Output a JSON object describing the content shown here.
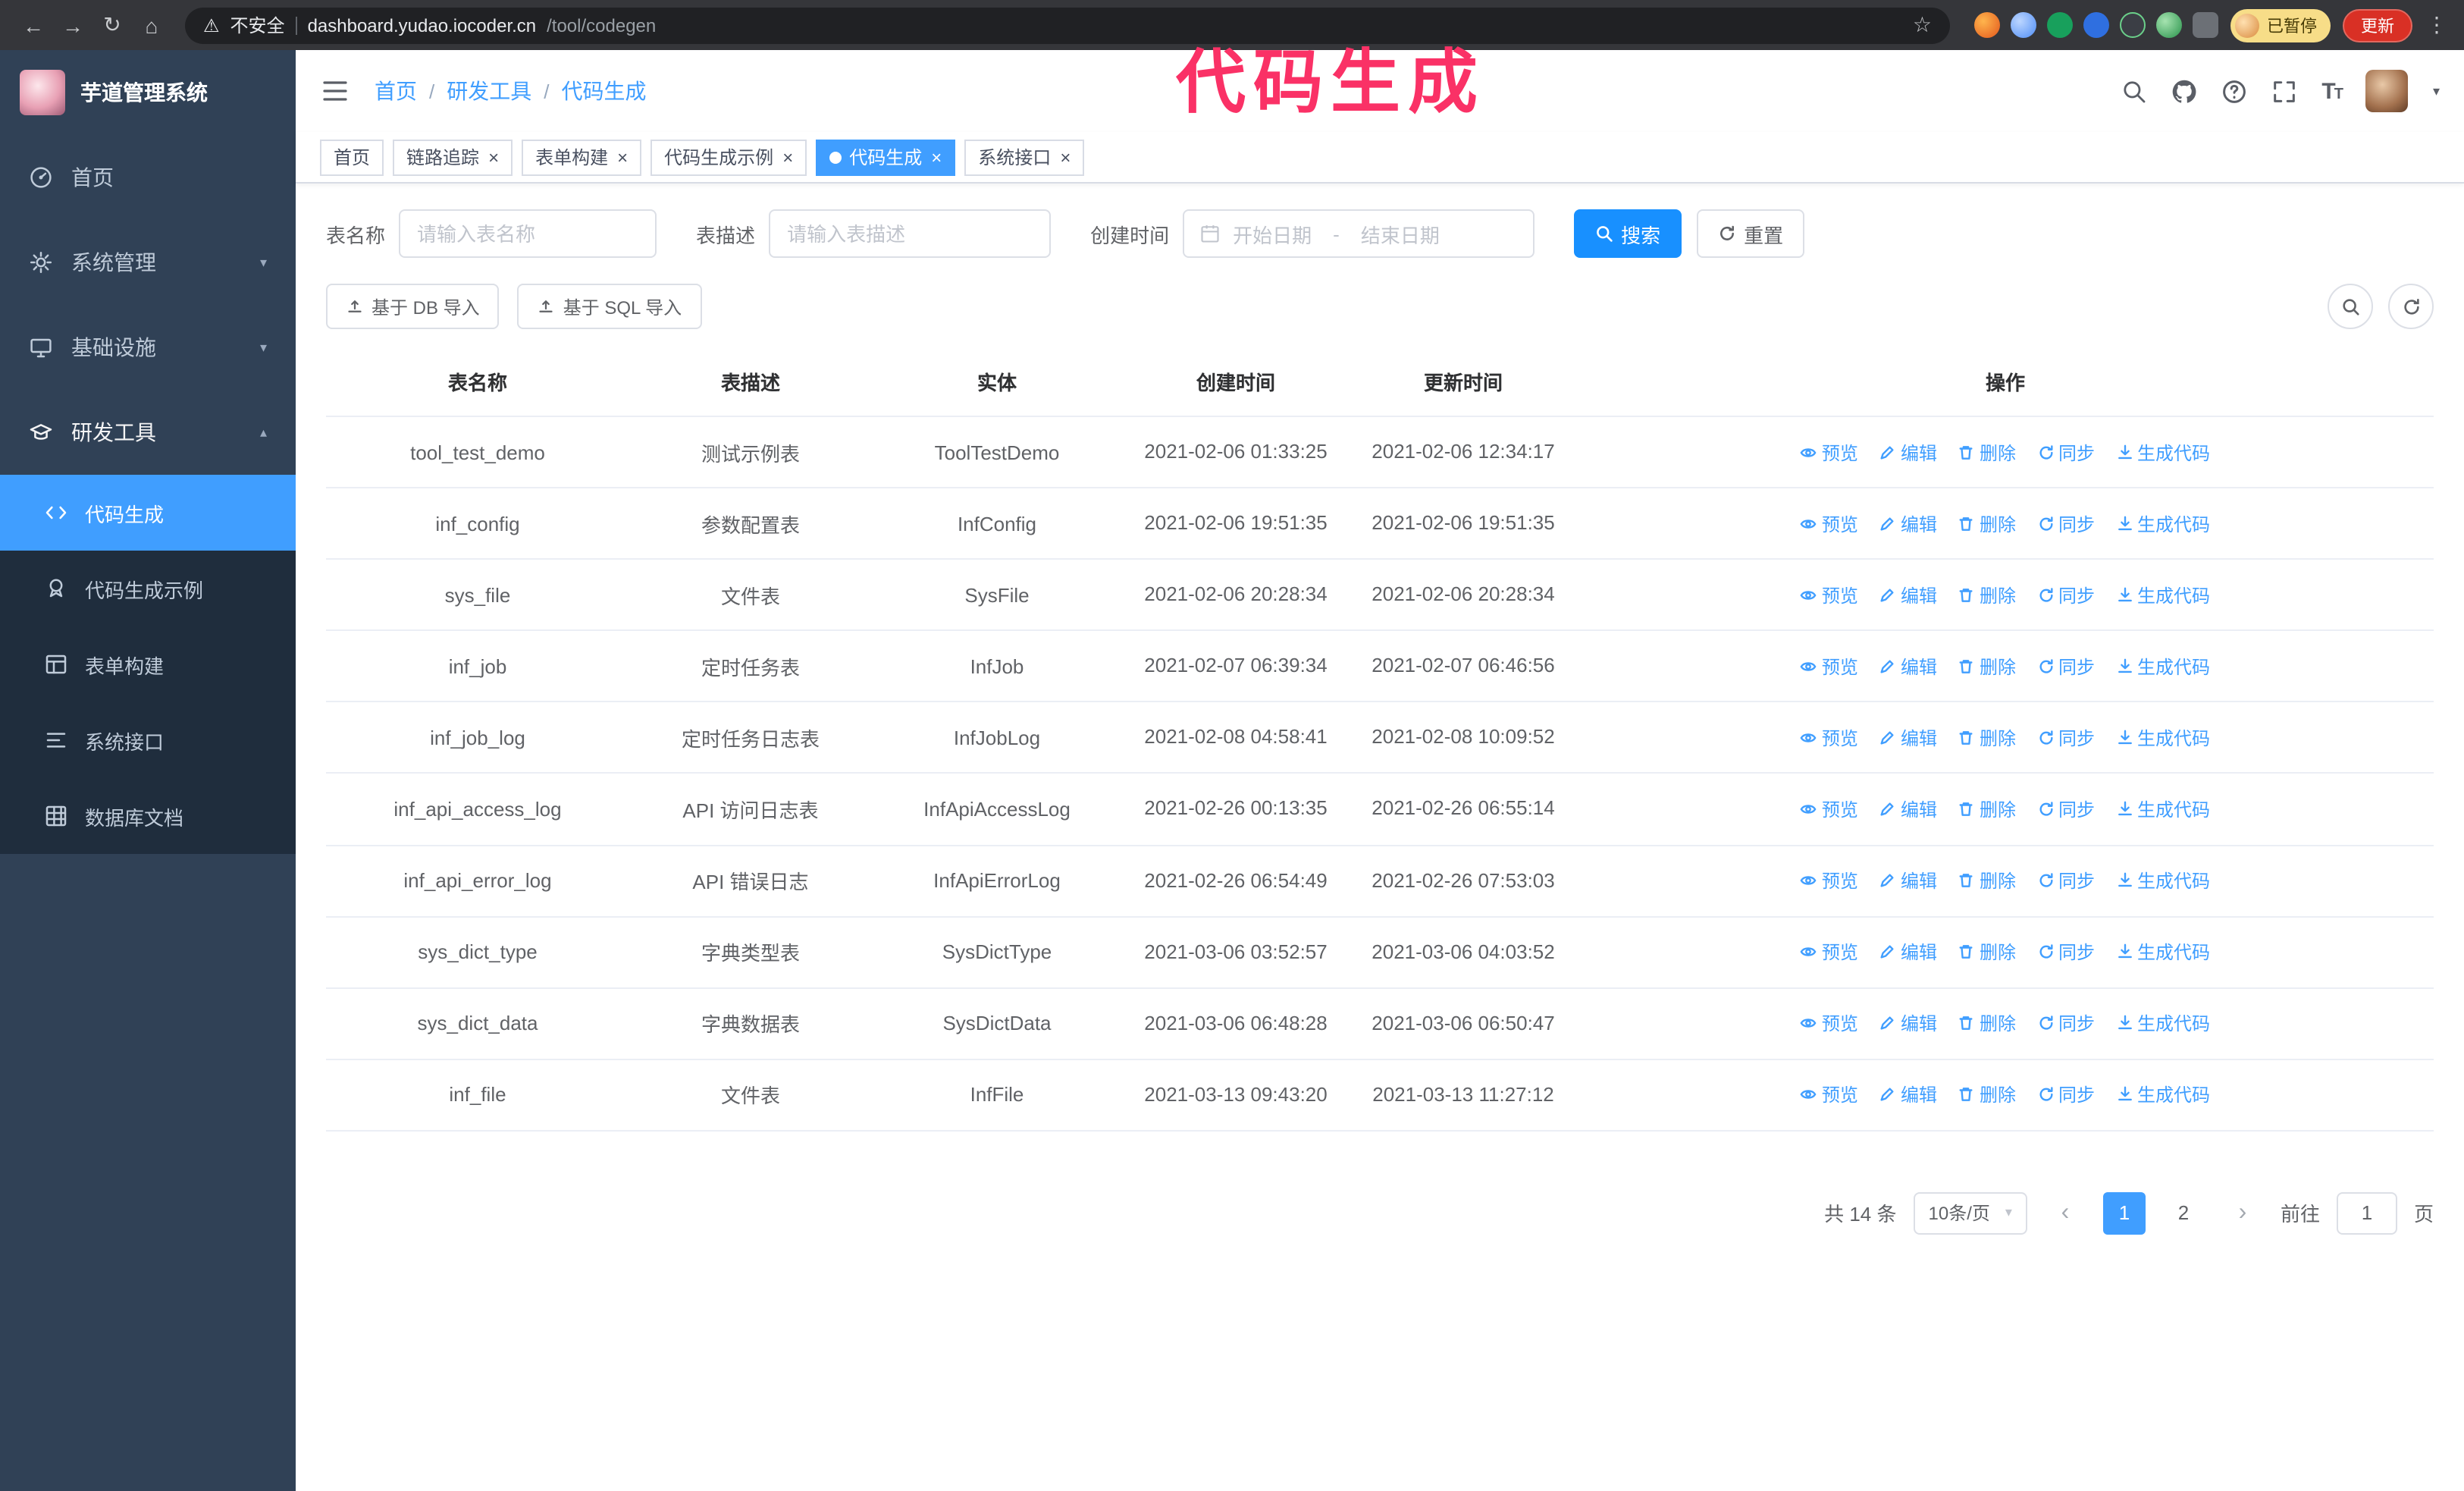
{
  "colors": {
    "primary": "#409eff",
    "primary_dark": "#1890ff",
    "annotation": "#fa3166",
    "update_red": "#d93025",
    "paused_yellow": "#f7dd88",
    "sidebar_bg": "#304156",
    "submenu_bg": "#1f2d3d"
  },
  "browser": {
    "security_label": "不安全",
    "url_host": "dashboard.yudao.iocoder.cn",
    "url_path": "/tool/codegen",
    "paused_badge": "已暂停",
    "update_label": "更新"
  },
  "annotation": {
    "text": "代码生成"
  },
  "sidebar": {
    "logo_title": "芋道管理系统",
    "items": [
      {
        "label": "首页",
        "icon": "dashboard-icon"
      },
      {
        "label": "系统管理",
        "icon": "gear-icon"
      },
      {
        "label": "基础设施",
        "icon": "monitor-icon"
      },
      {
        "label": "研发工具",
        "icon": "education-icon"
      }
    ],
    "subitems": [
      {
        "label": "代码生成",
        "icon": "code-icon",
        "active": true
      },
      {
        "label": "代码生成示例",
        "icon": "example-icon",
        "active": false
      },
      {
        "label": "表单构建",
        "icon": "form-icon",
        "active": false
      },
      {
        "label": "系统接口",
        "icon": "api-icon",
        "active": false
      },
      {
        "label": "数据库文档",
        "icon": "database-icon",
        "active": false
      }
    ]
  },
  "navbar": {
    "breadcrumb": [
      "首页",
      "研发工具",
      "代码生成"
    ],
    "separator": "/"
  },
  "tags": [
    {
      "label": "首页",
      "closable": false,
      "active": false
    },
    {
      "label": "链路追踪",
      "closable": true,
      "active": false
    },
    {
      "label": "表单构建",
      "closable": true,
      "active": false
    },
    {
      "label": "代码生成示例",
      "closable": true,
      "active": false
    },
    {
      "label": "代码生成",
      "closable": true,
      "active": true
    },
    {
      "label": "系统接口",
      "closable": true,
      "active": false
    }
  ],
  "filters": {
    "table_name_label": "表名称",
    "table_name_placeholder": "请输入表名称",
    "table_desc_label": "表描述",
    "table_desc_placeholder": "请输入表描述",
    "create_time_label": "创建时间",
    "date_start_placeholder": "开始日期",
    "date_separator": "-",
    "date_end_placeholder": "结束日期",
    "search_label": "搜索",
    "reset_label": "重置"
  },
  "toolbar": {
    "import_db_label": "基于 DB 导入",
    "import_sql_label": "基于 SQL 导入"
  },
  "table": {
    "columns": [
      "表名称",
      "表描述",
      "实体",
      "创建时间",
      "更新时间",
      "操作"
    ],
    "actions": [
      {
        "key": "preview",
        "label": "预览"
      },
      {
        "key": "edit",
        "label": "编辑"
      },
      {
        "key": "delete",
        "label": "删除"
      },
      {
        "key": "sync",
        "label": "同步"
      },
      {
        "key": "generate",
        "label": "生成代码"
      }
    ],
    "rows": [
      {
        "name": "tool_test_demo",
        "desc": "测试示例表",
        "entity": "ToolTestDemo",
        "created": "2021-02-06 01:33:25",
        "updated": "2021-02-06 12:34:17"
      },
      {
        "name": "inf_config",
        "desc": "参数配置表",
        "entity": "InfConfig",
        "created": "2021-02-06 19:51:35",
        "updated": "2021-02-06 19:51:35"
      },
      {
        "name": "sys_file",
        "desc": "文件表",
        "entity": "SysFile",
        "created": "2021-02-06 20:28:34",
        "updated": "2021-02-06 20:28:34"
      },
      {
        "name": "inf_job",
        "desc": "定时任务表",
        "entity": "InfJob",
        "created": "2021-02-07 06:39:34",
        "updated": "2021-02-07 06:46:56"
      },
      {
        "name": "inf_job_log",
        "desc": "定时任务日志表",
        "entity": "InfJobLog",
        "created": "2021-02-08 04:58:41",
        "updated": "2021-02-08 10:09:52"
      },
      {
        "name": "inf_api_access_log",
        "desc": "API 访问日志表",
        "entity": "InfApiAccessLog",
        "created": "2021-02-26 00:13:35",
        "updated": "2021-02-26 06:55:14"
      },
      {
        "name": "inf_api_error_log",
        "desc": "API 错误日志",
        "entity": "InfApiErrorLog",
        "created": "2021-02-26 06:54:49",
        "updated": "2021-02-26 07:53:03"
      },
      {
        "name": "sys_dict_type",
        "desc": "字典类型表",
        "entity": "SysDictType",
        "created": "2021-03-06 03:52:57",
        "updated": "2021-03-06 04:03:52"
      },
      {
        "name": "sys_dict_data",
        "desc": "字典数据表",
        "entity": "SysDictData",
        "created": "2021-03-06 06:48:28",
        "updated": "2021-03-06 06:50:47"
      },
      {
        "name": "inf_file",
        "desc": "文件表",
        "entity": "InfFile",
        "created": "2021-03-13 09:43:20",
        "updated": "2021-03-13 11:27:12"
      }
    ]
  },
  "pagination": {
    "total_label": "共 14 条",
    "page_size_label": "10条/页",
    "prev_label": "‹",
    "next_label": "›",
    "pages": [
      "1",
      "2"
    ],
    "goto_label": "前往",
    "goto_value": "1",
    "goto_unit": "页"
  }
}
